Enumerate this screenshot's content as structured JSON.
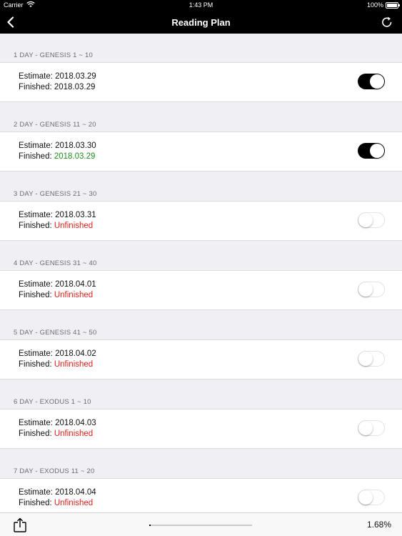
{
  "status_bar": {
    "carrier": "Carrier",
    "time": "1:43 PM",
    "battery": "100%"
  },
  "nav": {
    "title": "Reading Plan",
    "back_icon": "chevron-left-icon",
    "refresh_icon": "refresh-icon"
  },
  "sections": [
    {
      "header": "1 DAY - GENESIS 1 ~ 10",
      "estimate": "Estimate: 2018.03.29",
      "finished_label": "Finished: ",
      "finished_value": "2018.03.29",
      "finished_color": "#111111",
      "toggle_on": true
    },
    {
      "header": "2 DAY - GENESIS 11 ~ 20",
      "estimate": "Estimate: 2018.03.30",
      "finished_label": "Finished: ",
      "finished_value": "2018.03.29",
      "finished_color": "#1f8f1f",
      "toggle_on": true
    },
    {
      "header": "3 DAY - GENESIS 21 ~ 30",
      "estimate": "Estimate: 2018.03.31",
      "finished_label": "Finished: ",
      "finished_value": "Unfinished",
      "finished_color": "#e0201b",
      "toggle_on": false
    },
    {
      "header": "4 DAY - GENESIS 31 ~ 40",
      "estimate": "Estimate: 2018.04.01",
      "finished_label": "Finished: ",
      "finished_value": "Unfinished",
      "finished_color": "#e0201b",
      "toggle_on": false
    },
    {
      "header": "5 DAY - GENESIS 41 ~ 50",
      "estimate": "Estimate: 2018.04.02",
      "finished_label": "Finished: ",
      "finished_value": "Unfinished",
      "finished_color": "#e0201b",
      "toggle_on": false
    },
    {
      "header": "6 DAY - EXODUS 1 ~ 10",
      "estimate": "Estimate: 2018.04.03",
      "finished_label": "Finished: ",
      "finished_value": "Unfinished",
      "finished_color": "#e0201b",
      "toggle_on": false
    },
    {
      "header": "7 DAY - EXODUS 11 ~ 20",
      "estimate": "Estimate: 2018.04.04",
      "finished_label": "Finished: ",
      "finished_value": "Unfinished",
      "finished_color": "#e0201b",
      "toggle_on": false
    }
  ],
  "toolbar": {
    "share_icon": "share-icon",
    "progress_percent": 1.68,
    "progress_label": "1.68%"
  }
}
